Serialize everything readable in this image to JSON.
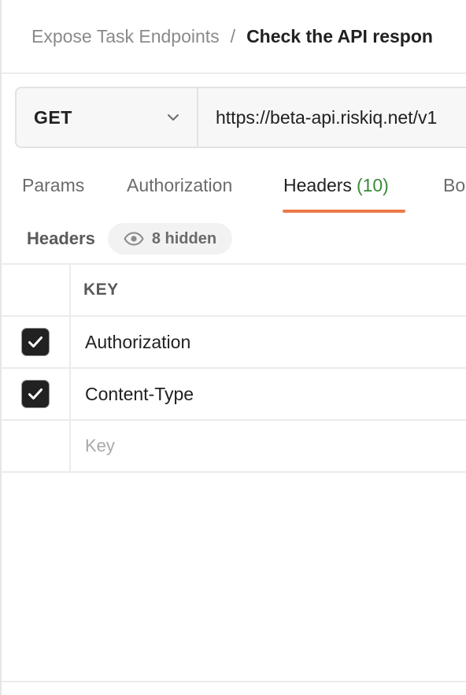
{
  "breadcrumb": {
    "parent": "Expose Task Endpoints",
    "separator": "/",
    "current": "Check the API respon"
  },
  "request": {
    "method": "GET",
    "url": "https://beta-api.riskiq.net/v1"
  },
  "tabs": [
    {
      "label": "Params"
    },
    {
      "label": "Authorization"
    },
    {
      "label": "Headers",
      "count": "(10)",
      "active": true
    },
    {
      "label": "Bo"
    }
  ],
  "headers_section": {
    "title": "Headers",
    "hidden_label": "8 hidden"
  },
  "table": {
    "column_key": "KEY",
    "rows": [
      {
        "key": "Authorization",
        "checked": true
      },
      {
        "key": "Content-Type",
        "checked": true
      }
    ],
    "new_row_placeholder": "Key"
  },
  "colors": {
    "accent_underline": "#ec7a4a",
    "count_green": "#3a8a3a",
    "checkbox_fill": "#212121"
  },
  "icons": {
    "method_dropdown": "chevron-down-icon",
    "hidden_toggle": "eye-icon",
    "checkbox": "check-icon"
  }
}
